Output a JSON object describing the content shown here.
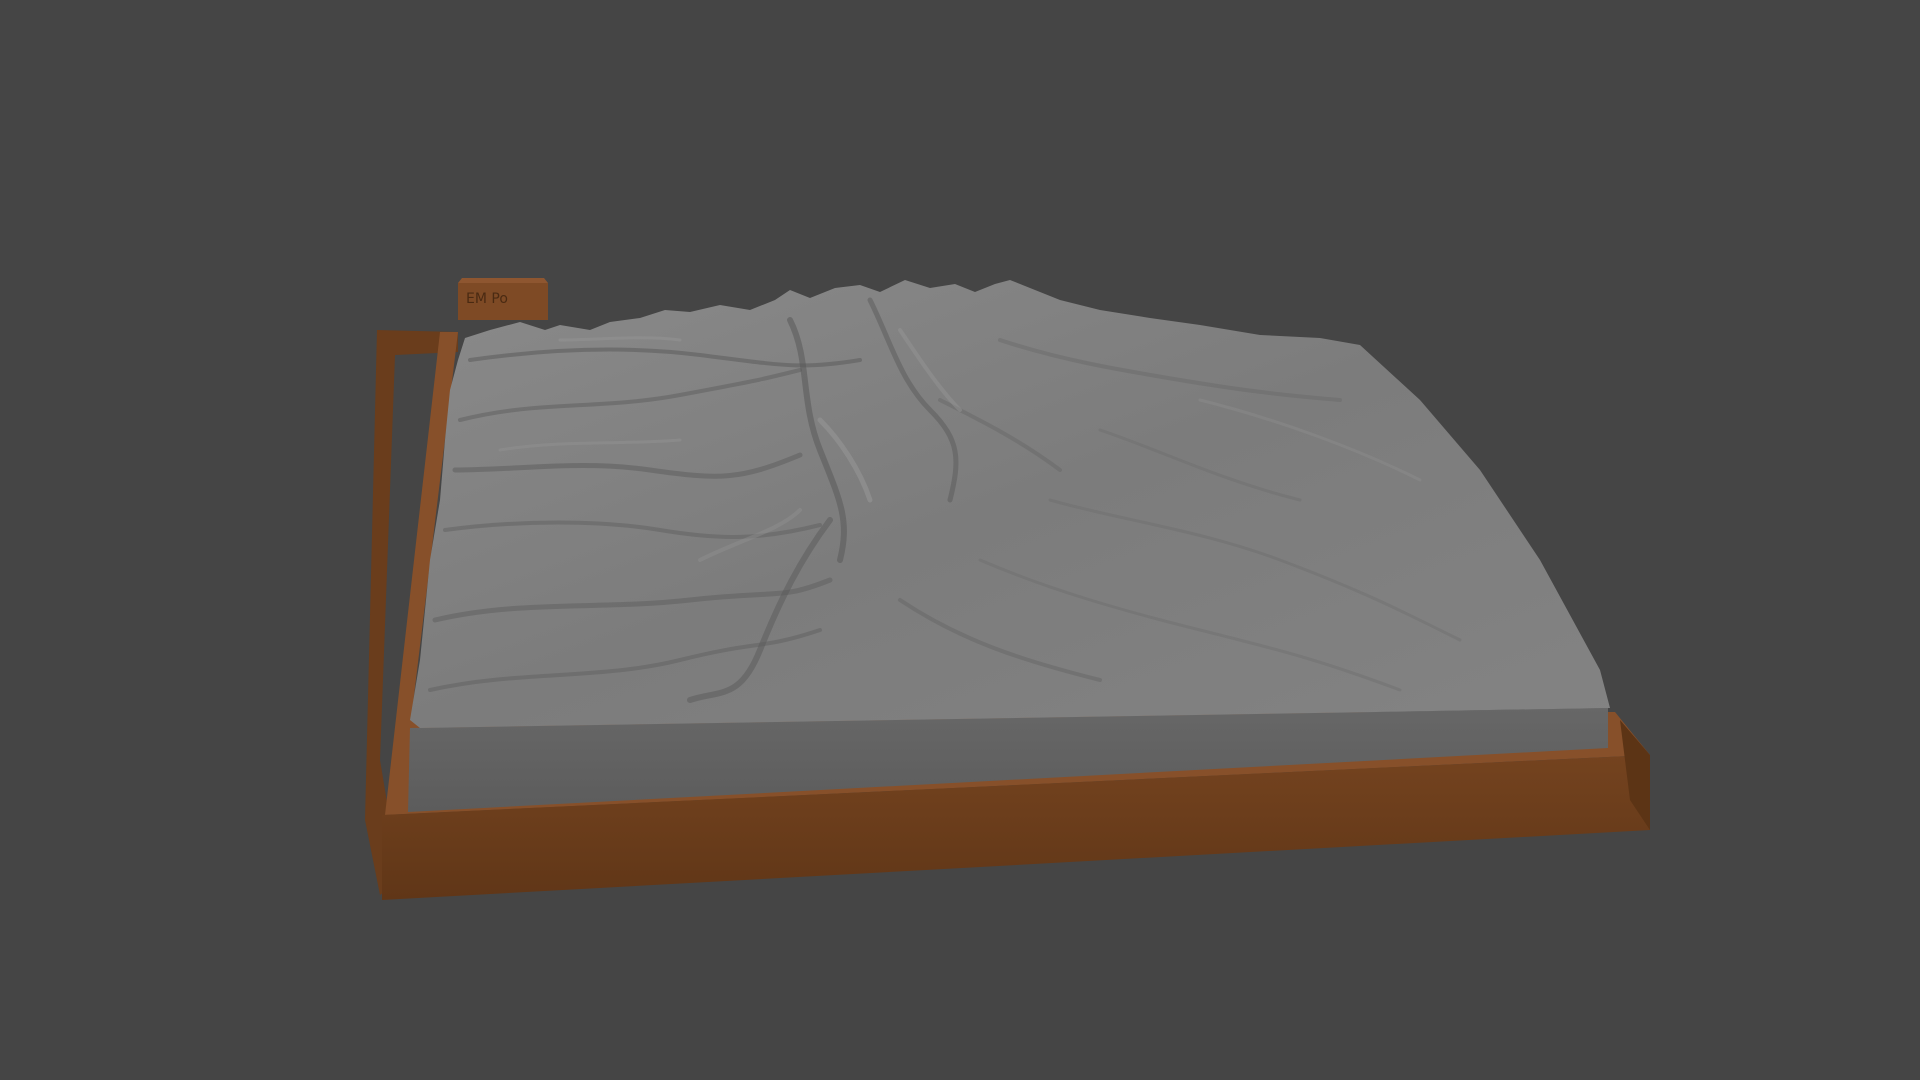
{
  "scene": {
    "background_color": "#454545",
    "terrain_color": "#7a7a7a",
    "terrain_side_color": "#626262",
    "base_color": "#6b3f1f",
    "base_top_color": "#87502a",
    "tag_text": "EM Po"
  }
}
